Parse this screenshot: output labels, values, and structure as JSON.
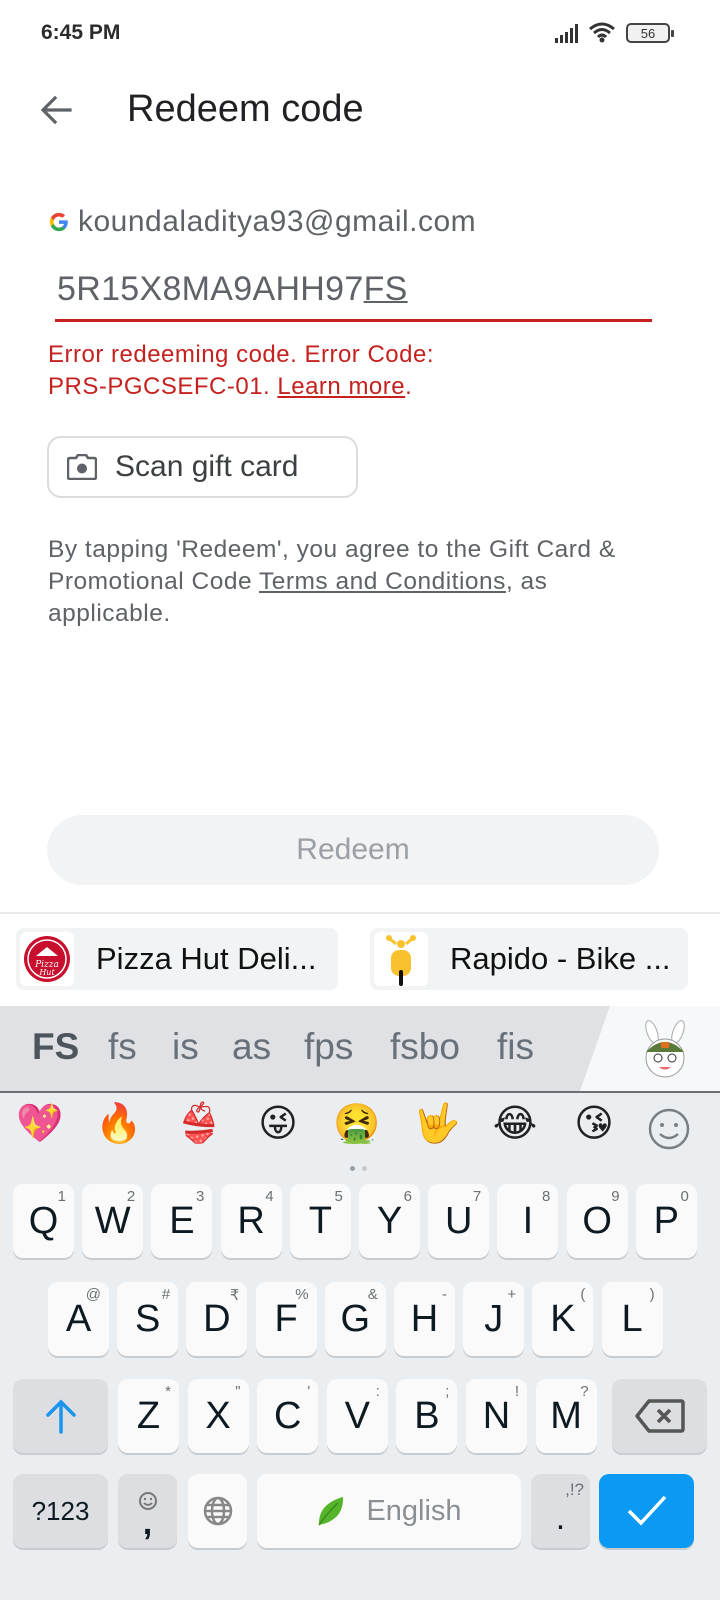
{
  "status_bar": {
    "time": "6:45 PM",
    "battery": "56"
  },
  "app_bar": {
    "title": "Redeem code"
  },
  "account": {
    "email": "koundaladitya93@gmail.com"
  },
  "code_input": {
    "value_committed": "5R15X8MA9AHH97",
    "value_composing": "FS"
  },
  "error": {
    "text_line1": "Error redeeming code. Error Code:",
    "text_line2": "PRS-PGCSEFC-01.",
    "link": "Learn more",
    "trail": "."
  },
  "scan_button": {
    "label": "Scan gift card"
  },
  "terms": {
    "prefix": "By tapping 'Redeem', you agree to the Gift Card & Promotional Code ",
    "link": "Terms and Conditions",
    "suffix": ", as applicable."
  },
  "redeem_button": {
    "label": "Redeem"
  },
  "app_suggestions": [
    {
      "name": "Pizza Hut Deli..."
    },
    {
      "name": "Rapido - Bike ..."
    }
  ],
  "keyboard": {
    "suggestions": [
      "FS",
      "fs",
      "is",
      "as",
      "fps",
      "fsbo",
      "fis"
    ],
    "emojis": [
      "💖",
      "🔥",
      "👙",
      "😜",
      "🤮",
      "🤟",
      "😂",
      "😘",
      "☺"
    ],
    "row1": [
      {
        "k": "Q",
        "h": "1"
      },
      {
        "k": "W",
        "h": "2"
      },
      {
        "k": "E",
        "h": "3"
      },
      {
        "k": "R",
        "h": "4"
      },
      {
        "k": "T",
        "h": "5"
      },
      {
        "k": "Y",
        "h": "6"
      },
      {
        "k": "U",
        "h": "7"
      },
      {
        "k": "I",
        "h": "8"
      },
      {
        "k": "O",
        "h": "9"
      },
      {
        "k": "P",
        "h": "0"
      }
    ],
    "row2": [
      {
        "k": "A",
        "h": "@"
      },
      {
        "k": "S",
        "h": "#"
      },
      {
        "k": "D",
        "h": "₹"
      },
      {
        "k": "F",
        "h": "%"
      },
      {
        "k": "G",
        "h": "&"
      },
      {
        "k": "H",
        "h": "-"
      },
      {
        "k": "J",
        "h": "+"
      },
      {
        "k": "K",
        "h": "("
      },
      {
        "k": "L",
        "h": ")"
      }
    ],
    "row3": [
      {
        "k": "Z",
        "h": "*"
      },
      {
        "k": "X",
        "h": "\""
      },
      {
        "k": "C",
        "h": "'"
      },
      {
        "k": "V",
        "h": ":"
      },
      {
        "k": "B",
        "h": ";"
      },
      {
        "k": "N",
        "h": "!"
      },
      {
        "k": "M",
        "h": "?"
      }
    ],
    "symbols_key": "?123",
    "comma_key": ",",
    "space_label": "English",
    "period_key": ".",
    "period_hint": ",!?",
    "colors": {
      "accent": "#0a9af3",
      "error": "#c5221f"
    }
  }
}
